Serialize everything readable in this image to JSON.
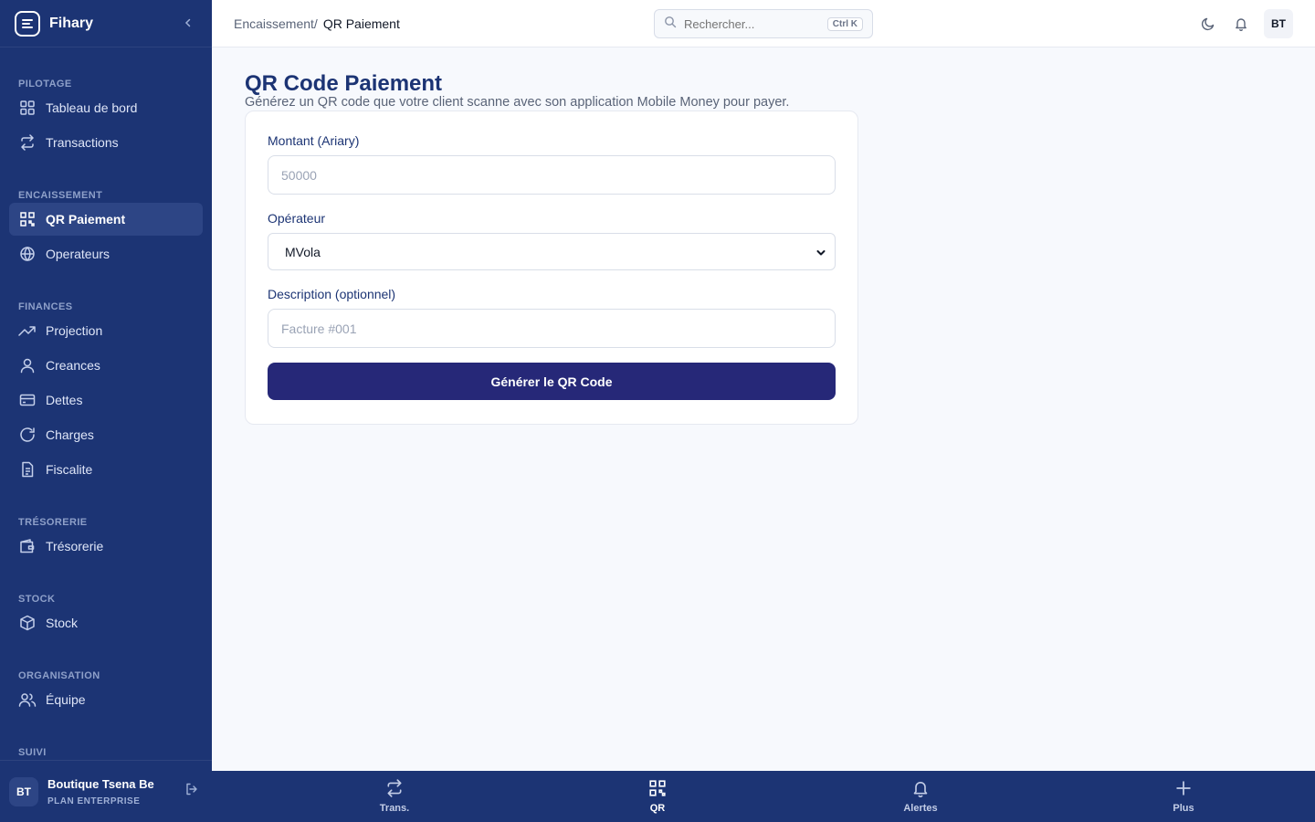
{
  "app": {
    "name": "Fihary"
  },
  "sidebar": {
    "sections": [
      {
        "title": "PILOTAGE",
        "items": [
          {
            "label": "Tableau de bord",
            "icon": "grid-icon"
          },
          {
            "label": "Transactions",
            "icon": "repeat-icon"
          }
        ]
      },
      {
        "title": "ENCAISSEMENT",
        "items": [
          {
            "label": "QR Paiement",
            "icon": "qr-icon",
            "active": true
          },
          {
            "label": "Operateurs",
            "icon": "globe-icon"
          }
        ]
      },
      {
        "title": "FINANCES",
        "items": [
          {
            "label": "Projection",
            "icon": "trending-up-icon"
          },
          {
            "label": "Creances",
            "icon": "user-icon"
          },
          {
            "label": "Dettes",
            "icon": "card-icon"
          },
          {
            "label": "Charges",
            "icon": "refresh-icon"
          },
          {
            "label": "Fiscalite",
            "icon": "file-icon"
          }
        ]
      },
      {
        "title": "TRÉSORERIE",
        "items": [
          {
            "label": "Trésorerie",
            "icon": "wallet-icon"
          }
        ]
      },
      {
        "title": "STOCK",
        "items": [
          {
            "label": "Stock",
            "icon": "box-icon"
          }
        ]
      },
      {
        "title": "ORGANISATION",
        "items": [
          {
            "label": "Équipe",
            "icon": "users-icon"
          }
        ]
      },
      {
        "title": "SUIVI",
        "items": []
      }
    ],
    "user": {
      "initials": "BT",
      "name": "Boutique Tsena Be",
      "plan": "PLAN ENTERPRISE"
    }
  },
  "topbar": {
    "breadcrumb_parent": "Encaissement/",
    "breadcrumb_current": "QR Paiement",
    "search_placeholder": "Rechercher...",
    "search_shortcut": "Ctrl K",
    "avatar_initials": "BT"
  },
  "page": {
    "title": "QR Code Paiement",
    "subtitle": "Générez un QR code que votre client scanne avec son application Mobile Money pour payer.",
    "form": {
      "amount_label": "Montant (Ariary)",
      "amount_placeholder": "50000",
      "operator_label": "Opérateur",
      "operator_value": "MVola",
      "description_label": "Description (optionnel)",
      "description_placeholder": "Facture #001",
      "submit_label": "Générer le QR Code"
    }
  },
  "bottom_nav": [
    {
      "label": "Trans.",
      "icon": "repeat-icon"
    },
    {
      "label": "QR",
      "icon": "qr-icon",
      "active": true
    },
    {
      "label": "Alertes",
      "icon": "bell-icon"
    },
    {
      "label": "Plus",
      "icon": "plus-icon"
    }
  ],
  "colors": {
    "sidebar_bg": "#1c3474",
    "primary_button": "#262878",
    "title": "#1c3474"
  }
}
